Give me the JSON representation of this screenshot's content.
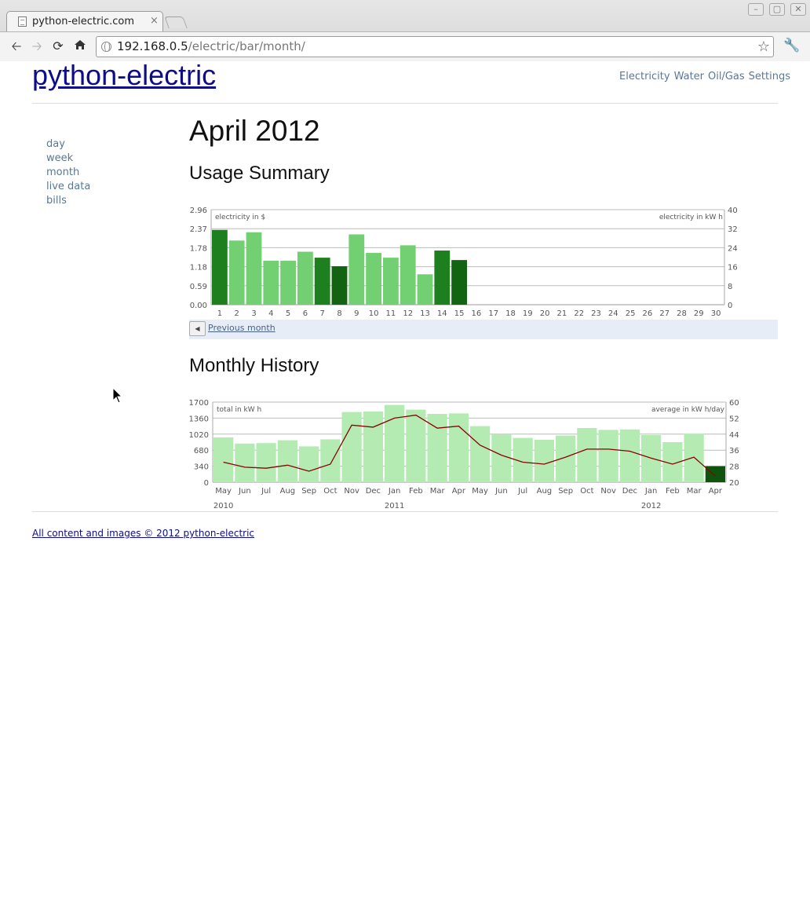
{
  "browser": {
    "tab_title": "python-electric.com",
    "tab_close": "×",
    "url_host": "192.168.0.5",
    "url_path": "/electric/bar/month/",
    "window_buttons": [
      "–",
      "▢",
      "✕"
    ]
  },
  "site": {
    "title": "python-electric",
    "nav": [
      "Electricity",
      "Water",
      "Oil/Gas",
      "Settings"
    ]
  },
  "sidebar": {
    "items": [
      "day",
      "week",
      "month",
      "live data",
      "bills"
    ]
  },
  "main": {
    "heading": "April 2012",
    "summary_heading": "Usage Summary",
    "history_heading": "Monthly History",
    "previous_month": "Previous month"
  },
  "footer": {
    "text": "All content and images © 2012 python-electric"
  },
  "chart_data": [
    {
      "type": "bar",
      "title": "",
      "ylabel_left": "electricity in $",
      "ylabel_right": "electricity in kW h",
      "categories": [
        "1",
        "2",
        "3",
        "4",
        "5",
        "6",
        "7",
        "8",
        "9",
        "10",
        "11",
        "12",
        "13",
        "14",
        "15",
        "16",
        "17",
        "18",
        "19",
        "20",
        "21",
        "22",
        "23",
        "24",
        "25",
        "26",
        "27",
        "28",
        "29",
        "30"
      ],
      "ylim_left": [
        0,
        2.96
      ],
      "ylim_right": [
        0,
        40
      ],
      "yticks_left": [
        "0.00",
        "0.59",
        "1.18",
        "1.78",
        "2.37",
        "2.96"
      ],
      "yticks_right": [
        "0",
        "8",
        "16",
        "24",
        "32",
        "40"
      ],
      "values_kwh": [
        31.5,
        27,
        30.5,
        18.5,
        18.5,
        22.3,
        19.8,
        16.2,
        29.6,
        21.8,
        19.8,
        25,
        12.8,
        22.8,
        18.8
      ],
      "bar_colors": [
        "#1d7f1d",
        "#72cf72",
        "#72cf72",
        "#72cf72",
        "#72cf72",
        "#72cf72",
        "#1d7f1d",
        "#126312",
        "#72cf72",
        "#72cf72",
        "#72cf72",
        "#72cf72",
        "#72cf72",
        "#1d7f1d",
        "#126312"
      ],
      "grid": true
    },
    {
      "type": "bar",
      "title": "",
      "ylabel_left": "total in kW h",
      "ylabel_right": "average in kW h/day",
      "categories": [
        "May",
        "Jun",
        "Jul",
        "Aug",
        "Sep",
        "Oct",
        "Nov",
        "Dec",
        "Jan",
        "Feb",
        "Mar",
        "Apr",
        "May",
        "Jun",
        "Jul",
        "Aug",
        "Sep",
        "Oct",
        "Nov",
        "Dec",
        "Jan",
        "Feb",
        "Mar",
        "Apr"
      ],
      "year_labels": [
        "2010",
        "2011",
        "2012"
      ],
      "ylim_left": [
        0,
        1700
      ],
      "ylim_right": [
        20,
        60
      ],
      "yticks_left": [
        "0",
        "340",
        "680",
        "1020",
        "1360",
        "1700"
      ],
      "yticks_right": [
        "20",
        "28",
        "36",
        "44",
        "52",
        "60"
      ],
      "series": [
        {
          "values": [
            950,
            820,
            830,
            890,
            760,
            910,
            1490,
            1500,
            1640,
            1540,
            1450,
            1460,
            1190,
            1020,
            940,
            900,
            990,
            1150,
            1110,
            1120,
            1000,
            850,
            1030,
            340
          ],
          "colors": [
            "#b3ebb3",
            "#b3ebb3",
            "#b3ebb3",
            "#b3ebb3",
            "#b3ebb3",
            "#b3ebb3",
            "#b3ebb3",
            "#b3ebb3",
            "#b3ebb3",
            "#b3ebb3",
            "#b3ebb3",
            "#b3ebb3",
            "#b3ebb3",
            "#b3ebb3",
            "#b3ebb3",
            "#b3ebb3",
            "#b3ebb3",
            "#b3ebb3",
            "#b3ebb3",
            "#b3ebb3",
            "#b3ebb3",
            "#b3ebb3",
            "#b3ebb3",
            "#0e540e"
          ]
        },
        {
          "type": "line",
          "color": "#8b0000",
          "values": [
            30,
            27.5,
            27,
            28.5,
            25.5,
            29,
            48.5,
            47.5,
            52,
            53.5,
            47,
            48,
            38.5,
            33.5,
            30,
            29,
            32.5,
            36.5,
            36.5,
            35.5,
            32,
            29,
            32.5,
            23
          ]
        }
      ],
      "grid": true
    }
  ]
}
